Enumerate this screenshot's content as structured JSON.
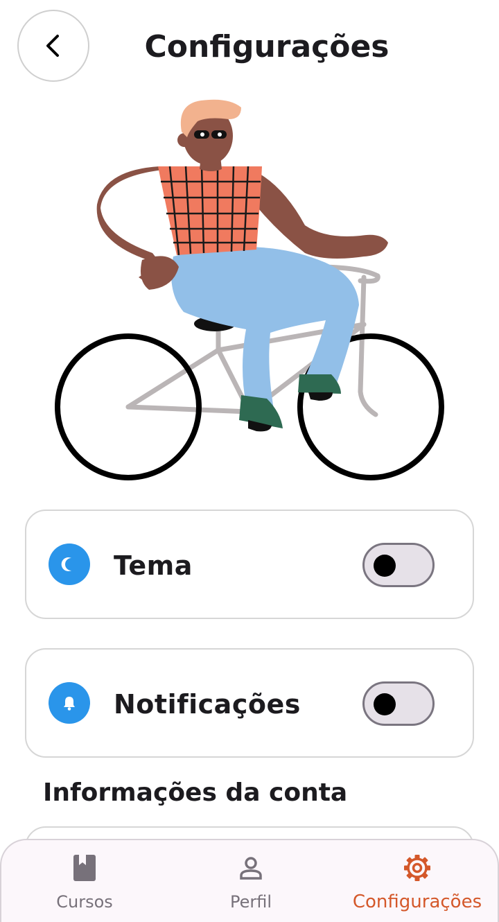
{
  "header": {
    "title": "Configurações",
    "back_icon": "chevron-left-icon"
  },
  "illustration": {
    "subject": "person-riding-bicycle"
  },
  "settings": [
    {
      "label": "Tema",
      "icon": "moon-icon",
      "icon_color": "#2a95ea",
      "toggle_on": false
    },
    {
      "label": "Notificações",
      "icon": "bell-icon",
      "icon_color": "#2a95ea",
      "toggle_on": false
    }
  ],
  "account_section": {
    "title": "Informações da conta"
  },
  "bottom_nav": {
    "items": [
      {
        "label": "Cursos",
        "icon": "book-icon",
        "active": false
      },
      {
        "label": "Perfil",
        "icon": "person-icon",
        "active": false
      },
      {
        "label": "Configurações",
        "icon": "gear-icon",
        "active": true
      }
    ],
    "active_color": "#d4582a",
    "inactive_color": "#77717a"
  }
}
